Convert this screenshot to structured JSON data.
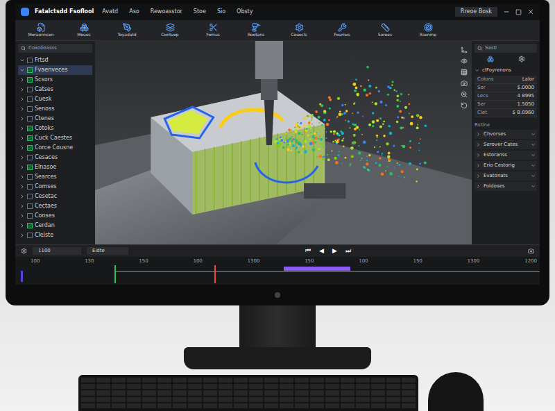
{
  "window": {
    "title": "Fatalctsdd Fsoflool"
  },
  "menus": [
    "Avatd",
    "Aso",
    "Rewoasstor",
    "Stoe",
    "Sio",
    "Obsty"
  ],
  "account": {
    "label": "Rreoe Bosk"
  },
  "toolbar": [
    {
      "label": "Moraonncen"
    },
    {
      "label": "Moues"
    },
    {
      "label": "Toyadatd"
    },
    {
      "label": "Contuop"
    },
    {
      "label": "Fomus"
    },
    {
      "label": "Rootans"
    },
    {
      "label": "Couecls"
    },
    {
      "label": "Foumes"
    },
    {
      "label": "Sorees"
    },
    {
      "label": "Rsenme"
    }
  ],
  "tree": {
    "search_placeholder": "Coxolleasss",
    "items": [
      {
        "label": "Frtsd",
        "expanded": true,
        "checked": false,
        "selected": false
      },
      {
        "label": "Fvaenveces",
        "expanded": true,
        "checked": true,
        "selected": true
      },
      {
        "label": "Scsors",
        "expanded": false,
        "checked": true,
        "selected": false
      },
      {
        "label": "Catses",
        "expanded": false,
        "checked": false,
        "selected": false
      },
      {
        "label": "Cuesk",
        "expanded": false,
        "checked": false,
        "selected": false
      },
      {
        "label": "Senoss",
        "expanded": false,
        "checked": false,
        "selected": false
      },
      {
        "label": "Ctenes",
        "expanded": false,
        "checked": false,
        "selected": false
      },
      {
        "label": "Cotoks",
        "expanded": false,
        "checked": true,
        "selected": false
      },
      {
        "label": "Cuck Caestes",
        "expanded": false,
        "checked": true,
        "selected": false
      },
      {
        "label": "Corce Cousne",
        "expanded": false,
        "checked": true,
        "selected": false
      },
      {
        "label": "Cesaces",
        "expanded": false,
        "checked": false,
        "selected": false
      },
      {
        "label": "Elnasoe",
        "expanded": false,
        "checked": true,
        "selected": false
      },
      {
        "label": "Searces",
        "expanded": false,
        "checked": false,
        "selected": false
      },
      {
        "label": "Comses",
        "expanded": false,
        "checked": false,
        "selected": false
      },
      {
        "label": "Cesetac",
        "expanded": false,
        "checked": false,
        "selected": false
      },
      {
        "label": "Cectaes",
        "expanded": false,
        "checked": false,
        "selected": false
      },
      {
        "label": "Conses",
        "expanded": false,
        "checked": false,
        "selected": false
      },
      {
        "label": "Cerdan",
        "expanded": false,
        "checked": true,
        "selected": false
      },
      {
        "label": "Cleiste",
        "expanded": false,
        "checked": false,
        "selected": false
      }
    ]
  },
  "right_panel": {
    "search_placeholder": "Sastl",
    "section": "cIFoyrenons",
    "properties": [
      {
        "name": "Colons",
        "value": "Lalor"
      },
      {
        "name": "Sor",
        "value": "$.0000"
      },
      {
        "name": "Lecs",
        "value": "4 8995"
      },
      {
        "name": "Ser",
        "value": "1.5050"
      },
      {
        "name": "Clet",
        "value": "$ B.0960"
      }
    ],
    "groups_title": "Rstlne",
    "groups": [
      {
        "label": "Chvorses",
        "expanded": false
      },
      {
        "label": "Serover Cates",
        "expanded": false
      },
      {
        "label": "Estoranss",
        "expanded": false
      },
      {
        "label": "Erio Cestorig",
        "expanded": false
      },
      {
        "label": "Evatonats",
        "expanded": false
      },
      {
        "label": "Foldoses",
        "expanded": false
      }
    ]
  },
  "playback": {
    "field": "1100",
    "mode": "Eidte",
    "controls": [
      "⏮",
      "◀",
      "▶",
      "⏭"
    ]
  },
  "timeline": {
    "ticks": [
      "100",
      "130",
      "150",
      "100",
      "1300",
      "150",
      "100",
      "150",
      "1300",
      "1200"
    ],
    "markers": [
      {
        "color": "#22c55e",
        "level": 0.17
      },
      {
        "color": "#ef4444",
        "level": 0.365
      }
    ],
    "range": {
      "start": 0.5,
      "end": 0.63,
      "color": "#8b5cf6"
    }
  }
}
